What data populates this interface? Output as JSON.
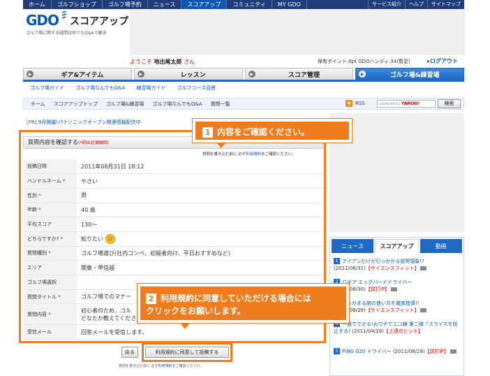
{
  "topnav": {
    "items": [
      "ホーム",
      "ゴルフショップ",
      "ゴルフ場予約",
      "ニュース",
      "スコアアップ",
      "コミュニティ",
      "MY GDO"
    ],
    "active_index": 4,
    "util": [
      "サービス紹介",
      "ヘルプ",
      "サイトマップ"
    ]
  },
  "header": {
    "logo": "GDO",
    "section_title": "スコアアップ",
    "tagline": "ゴルフ場に関する疑問は何でもQ&Aで解決"
  },
  "user": {
    "welcome_prefix": "ようこそ",
    "name": "地出尾太郎",
    "suffix": "さん",
    "points": "保有ポイント:0pt GDOハンディ:34(暫定)",
    "logout": "ログアウト"
  },
  "tabs": [
    {
      "label": "ギア&アイテム"
    },
    {
      "label": "レッスン"
    },
    {
      "label": "スコア管理"
    },
    {
      "label": "ゴルフ場&練習場"
    }
  ],
  "subnav": [
    "ゴルフ場ガイド",
    "ゴルフ場なんでもQ&A",
    "練習場ガイド",
    "ゴルフコース百景"
  ],
  "breadcrumb": [
    "ホーム",
    "スコアアップトップ",
    "ゴルフ場&練習場",
    "ゴルフ場なんでもQ&A",
    "質問一覧"
  ],
  "rss": "RSS",
  "search": {
    "powered": "powered by",
    "brand": "YAHOO!",
    "button": "検索"
  },
  "announcement": {
    "tag": "[PR]",
    "text": "9月開催!パナソニックオープン関連情報配信中"
  },
  "form": {
    "title": "質問内容を確認する",
    "required_note": "(*印は必須項目)",
    "note_prefix": "質問を書き込む前に 必ず",
    "note_link": "利用規約",
    "note_suffix": "をご確認ください。",
    "rows": [
      {
        "label": "投稿日時",
        "value": "2011年08月31日 18:12",
        "required": ""
      },
      {
        "label": "ハンドルネーム",
        "value": "やさい",
        "required": "*"
      },
      {
        "label": "性別",
        "value": "男",
        "required": "*"
      },
      {
        "label": "年齢",
        "value": "40 歳",
        "required": "*"
      },
      {
        "label": "平均スコア",
        "value": "130〜",
        "required": ""
      },
      {
        "label": "どちらですか?",
        "value": "知りたい",
        "required": "*"
      },
      {
        "label": "質問種別",
        "value": "ゴルフ場選び(社内コンペ、初級者向け、平日おすすめなど)",
        "required": "*"
      },
      {
        "label": "エリア",
        "value": "関東・甲信越",
        "required": ""
      },
      {
        "label": "ゴルフ場選択",
        "value": "",
        "required": ""
      },
      {
        "label": "質問タイトル",
        "value": "ゴルフ場でのマナー",
        "required": "*"
      },
      {
        "label": "質問内容",
        "value": "初心者のため、ゴル",
        "value2": "どなたか教えてくださ",
        "required": "*"
      },
      {
        "label": "受信メール",
        "value": "回答メールを受信します。",
        "required": ""
      }
    ]
  },
  "buttons": {
    "back": "戻る",
    "agree": "利用規約に同意して投稿する"
  },
  "bottom_note": {
    "prefix": "質問を書き込む前に 必ず",
    "link": "利用規約",
    "suffix": "をご確認ください。"
  },
  "news": {
    "tabs": [
      "ニュース",
      "スコアアップ",
      "動画"
    ],
    "active_index": 1,
    "items": [
      {
        "num": "1",
        "title": "アイアンだけが引っかかる超常現象!?",
        "date": "(2011/08/31)",
        "src": "【サイエンスフィット】"
      },
      {
        "num": "2",
        "title": "ロギア エッグバードドライバー",
        "date": "(2011/08/30)",
        "src": "【試打IP】"
      },
      {
        "num": "3",
        "title": "がっかまる腕の使い方を徹底指導!!",
        "date": "(2011/08/29)",
        "src": "【サイエンスフィット】"
      },
      {
        "num": "4",
        "title": "一畳でできる!おウチでエコ練 第二弾「スライスを防止する!",
        "date": "(2011/04/19)",
        "src": "【上達のヒント】"
      },
      {
        "num": "5",
        "title": "PING G20 ドライバー",
        "date": "(2011/08/28)",
        "src": "【試打IP】"
      }
    ]
  },
  "callouts": {
    "one_num": "1",
    "one_text": "内容をご確認ください。",
    "two_num": "2",
    "two_line1": "利用規約に同意していただける場合には",
    "two_line2": "クリックをお願いします。"
  },
  "colors": {
    "nav_blue": "#1f3d7a",
    "accent_blue": "#1f69c2",
    "callout_orange": "#f07d1d",
    "required_red": "#cc0000"
  }
}
